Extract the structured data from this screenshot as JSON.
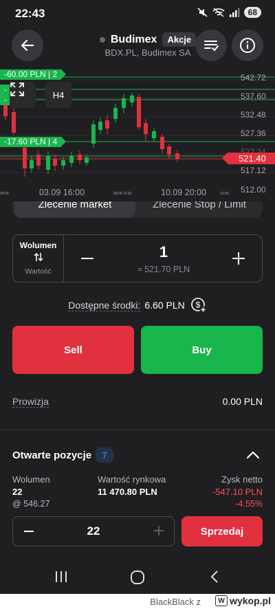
{
  "status_bar": {
    "time": "22:43",
    "battery": "68"
  },
  "header": {
    "title": "Budimex",
    "tag": "Akcje",
    "subtitle": "BDX.PL, Budimex SA"
  },
  "chart": {
    "y_labels": [
      "542.72",
      "537.60",
      "532.48",
      "527.36",
      "522.24",
      "517.12",
      "512.00"
    ],
    "current_price": "521.40",
    "x_labels": [
      "03.09 16:00",
      "10.09 20:00"
    ],
    "x_small_labels": [
      "08:00",
      "08.09 12:00",
      "12:00"
    ],
    "order_lines": [
      "-60.00 PLN | 2",
      "-",
      "-",
      "-17.60 PLN | 4"
    ],
    "timeframe": "H4"
  },
  "order_tabs": {
    "active": "Zlecenie market",
    "inactive": "Zlecenie Stop / Limit"
  },
  "volume": {
    "label": "Wolumen",
    "alt_label": "Wartość",
    "value": "1",
    "approx": "≈ 521.70 PLN"
  },
  "funds": {
    "label": "Dostępne środki:",
    "value": "6.60 PLN"
  },
  "actions": {
    "sell": "Sell",
    "buy": "Buy"
  },
  "fee": {
    "label": "Prowizja",
    "value": "0.00 PLN"
  },
  "positions": {
    "title": "Otwarte pozycje",
    "count": "7",
    "headers": {
      "volume": "Wolumen",
      "market_value": "Wartość rynkowa",
      "net_profit": "Zysk netto"
    },
    "volume": "22",
    "avg_price": "@ 546.27",
    "market_value": "11 470.80 PLN",
    "net_profit": "-547.10 PLN",
    "net_profit_pct": "-4.55%",
    "close_qty": "22",
    "close_button": "Sprzedaj"
  },
  "watermark": {
    "user": "BlackBlack",
    "sep": "z",
    "site": "wykop.pl"
  },
  "colors": {
    "sell": "#e2313e",
    "buy": "#19b64d",
    "background": "#1f1f22"
  }
}
